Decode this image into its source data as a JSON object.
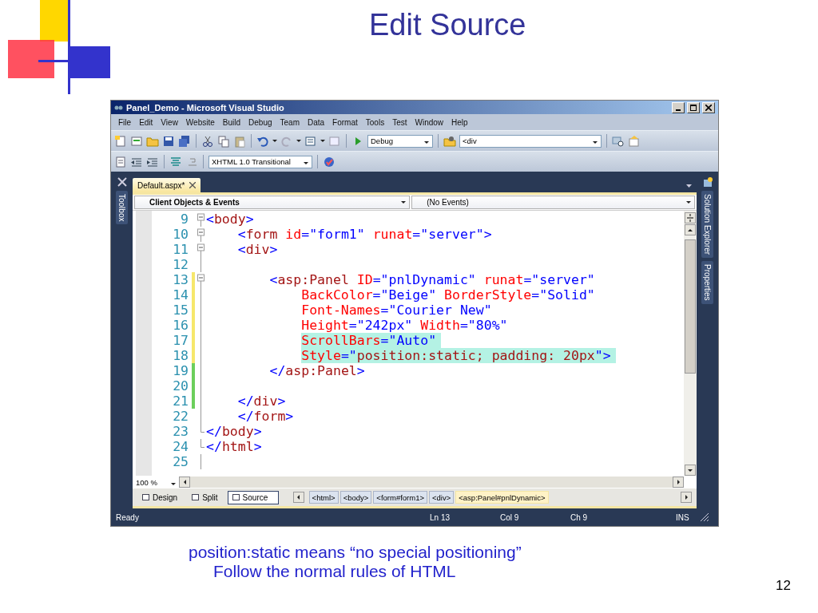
{
  "slide": {
    "title": "Edit Source",
    "captions": [
      "position:static means “no special positioning”",
      "Follow the normal rules of HTML"
    ],
    "page_number": "12"
  },
  "window": {
    "title": "Panel_Demo - Microsoft Visual Studio"
  },
  "menu": [
    "File",
    "Edit",
    "View",
    "Website",
    "Build",
    "Debug",
    "Team",
    "Data",
    "Format",
    "Tools",
    "Test",
    "Window",
    "Help"
  ],
  "toolbar": {
    "configuration": "Debug",
    "element": "<div",
    "doctype": "XHTML 1.0 Transitional"
  },
  "side_tabs": {
    "left": [
      "Toolbox"
    ],
    "right": [
      "Solution Explorer",
      "Properties"
    ]
  },
  "document_tabs": [
    {
      "label": "Default.aspx*",
      "selected": true
    }
  ],
  "navigation": {
    "objects": "Client Objects & Events",
    "events": "(No Events)"
  },
  "code": {
    "lines": [
      {
        "number": "9",
        "kind": "document",
        "foldable": true,
        "block_end": false,
        "highlighted": false,
        "words": [
          [
            {
              "kind": "punct",
              "text": "<"
            },
            {
              "kind": "tag",
              "text": "body"
            },
            {
              "kind": "punct",
              "text": ">"
            }
          ]
        ]
      },
      {
        "number": "10",
        "kind": "form",
        "foldable": true,
        "block_end": false,
        "highlighted": false,
        "words": [
          [
            {
              "kind": "punct",
              "text": "<"
            },
            {
              "kind": "tag",
              "text": "form"
            }
          ],
          [
            {
              "kind": "attr",
              "text": "id"
            },
            {
              "kind": "punct",
              "text": "="
            },
            {
              "kind": "value",
              "text": "\"form1\""
            }
          ],
          [
            {
              "kind": "attr",
              "text": "runat"
            },
            {
              "kind": "punct",
              "text": "="
            },
            {
              "kind": "value",
              "text": "\"server\""
            },
            {
              "kind": "punct",
              "text": ">"
            }
          ]
        ]
      },
      {
        "number": "11",
        "kind": "form",
        "foldable": true,
        "block_end": false,
        "highlighted": false,
        "words": [
          [
            {
              "kind": "punct",
              "text": "<"
            },
            {
              "kind": "tag",
              "text": "div"
            },
            {
              "kind": "punct",
              "text": ">"
            }
          ]
        ]
      },
      {
        "number": "12",
        "kind": "blank",
        "foldable": false,
        "block_end": false,
        "highlighted": false
      },
      {
        "number": "13",
        "kind": "content",
        "foldable": true,
        "block_end": false,
        "color": "#f6e76b",
        "highlighted": false,
        "words": [
          [
            {
              "kind": "punct",
              "text": "<"
            },
            {
              "kind": "tag",
              "text": "asp:Panel"
            }
          ],
          [
            {
              "kind": "attr",
              "text": "ID"
            },
            {
              "kind": "punct",
              "text": "="
            },
            {
              "kind": "value",
              "text": "\"pnlDynamic\""
            }
          ],
          [
            {
              "kind": "attr",
              "text": "runat"
            },
            {
              "kind": "punct",
              "text": "="
            },
            {
              "kind": "value",
              "text": "\"server\""
            }
          ]
        ]
      },
      {
        "number": "14",
        "kind": "attribute",
        "foldable": false,
        "block_end": false,
        "color": "#f6e76b",
        "highlighted": false,
        "words": [
          [
            {
              "kind": "attr",
              "text": "BackColor"
            },
            {
              "kind": "punct",
              "text": "="
            },
            {
              "kind": "value",
              "text": "\"Beige\""
            }
          ],
          [
            {
              "kind": "attr",
              "text": "BorderStyle"
            },
            {
              "kind": "punct",
              "text": "="
            },
            {
              "kind": "value",
              "text": "\"Solid\""
            }
          ]
        ]
      },
      {
        "number": "15",
        "kind": "attribute",
        "foldable": false,
        "block_end": false,
        "color": "#f6e76b",
        "highlighted": false,
        "words": [
          [
            {
              "kind": "attr",
              "text": "Font-Names"
            },
            {
              "kind": "punct",
              "text": "="
            },
            {
              "kind": "value",
              "text": "\"Courier New\""
            }
          ]
        ]
      },
      {
        "number": "16",
        "kind": "attribute",
        "foldable": false,
        "block_end": false,
        "color": "#f6e76b",
        "highlighted": false,
        "words": [
          [
            {
              "kind": "attr",
              "text": "Height"
            },
            {
              "kind": "punct",
              "text": "="
            },
            {
              "kind": "value",
              "text": "\"242px\""
            }
          ],
          [
            {
              "kind": "attr",
              "text": "Width"
            },
            {
              "kind": "punct",
              "text": "="
            },
            {
              "kind": "value",
              "text": "\"80%\""
            }
          ]
        ]
      },
      {
        "number": "17",
        "kind": "attribute",
        "foldable": false,
        "block_end": false,
        "color": "#f6e76b",
        "highlighted": true,
        "words": [
          [
            {
              "kind": "attr",
              "text": "ScrollBars"
            },
            {
              "kind": "punct",
              "text": "="
            },
            {
              "kind": "value",
              "text": "\"Auto\""
            }
          ]
        ]
      },
      {
        "number": "18",
        "kind": "attribute",
        "foldable": false,
        "block_end": false,
        "color": "#f6e76b",
        "highlighted": true,
        "words": [
          [
            {
              "kind": "attr",
              "text": "Style"
            },
            {
              "kind": "punct",
              "text": "=\""
            },
            {
              "kind": "css",
              "text": "position:static; padding: 20px"
            },
            {
              "kind": "punct",
              "text": "\">"
            }
          ]
        ]
      },
      {
        "number": "19",
        "kind": "content",
        "foldable": false,
        "block_end": false,
        "color": "#6ccf5c",
        "highlighted": false,
        "words": [
          [
            {
              "kind": "punct",
              "text": "</"
            },
            {
              "kind": "tag",
              "text": "asp:Panel"
            },
            {
              "kind": "punct",
              "text": ">"
            }
          ]
        ]
      },
      {
        "number": "20",
        "kind": "blank",
        "foldable": false,
        "block_end": false,
        "color": "#6ccf5c",
        "highlighted": false
      },
      {
        "number": "21",
        "kind": "form",
        "foldable": false,
        "block_end": false,
        "color": "#6ccf5c",
        "highlighted": false,
        "words": [
          [
            {
              "kind": "punct",
              "text": "</"
            },
            {
              "kind": "tag",
              "text": "div"
            },
            {
              "kind": "punct",
              "text": ">"
            }
          ]
        ]
      },
      {
        "number": "22",
        "kind": "form",
        "foldable": false,
        "block_end": false,
        "highlighted": false,
        "words": [
          [
            {
              "kind": "punct",
              "text": "</"
            },
            {
              "kind": "tag",
              "text": "form"
            },
            {
              "kind": "punct",
              "text": ">"
            }
          ]
        ]
      },
      {
        "number": "23",
        "kind": "document",
        "foldable": false,
        "block_end": true,
        "highlighted": false,
        "words": [
          [
            {
              "kind": "punct",
              "text": "</"
            },
            {
              "kind": "tag",
              "text": "body"
            },
            {
              "kind": "punct",
              "text": ">"
            }
          ]
        ]
      },
      {
        "number": "24",
        "kind": "document",
        "foldable": false,
        "block_end": true,
        "highlighted": false,
        "words": [
          [
            {
              "kind": "punct",
              "text": "</"
            },
            {
              "kind": "tag",
              "text": "html"
            },
            {
              "kind": "punct",
              "text": ">"
            }
          ]
        ]
      },
      {
        "number": "25",
        "kind": "blank",
        "foldable": false,
        "block_end": false,
        "highlighted": false
      }
    ]
  },
  "zoom": "100 %",
  "views": [
    {
      "label": "Design",
      "selected": false
    },
    {
      "label": "Split",
      "selected": false
    },
    {
      "label": "Source",
      "selected": true
    }
  ],
  "breadcrumbs": [
    {
      "label": "<html>",
      "selected": false
    },
    {
      "label": "<body>",
      "selected": false
    },
    {
      "label": "<form#form1>",
      "selected": false
    },
    {
      "label": "<div>",
      "selected": false
    },
    {
      "label": "<asp:Panel#pnlDynamic>",
      "selected": true
    }
  ],
  "status_bar": {
    "message": "Ready",
    "line": "Ln 13",
    "column": "Col 9",
    "character": "Ch 9",
    "mode": "INS"
  }
}
